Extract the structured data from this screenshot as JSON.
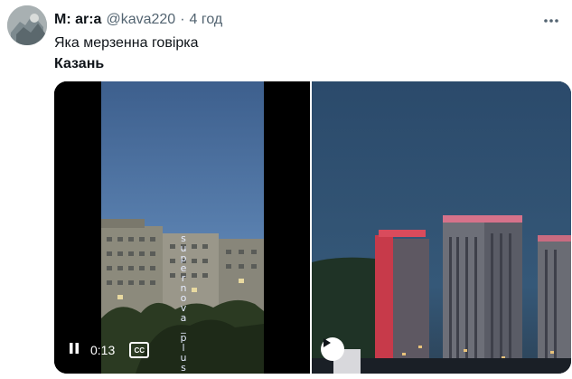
{
  "tweet": {
    "display_name": "M: ar:a",
    "handle": "@kava220",
    "separator": "·",
    "time": "4 год",
    "text": "Яка мерзенна говірка",
    "bold_text": "Казань"
  },
  "video_left": {
    "elapsed": "0:13",
    "watermark": "supernova_plus",
    "icons": [
      "pause-icon",
      "closed-captions-icon"
    ],
    "cc_label": "CC"
  },
  "video_right": {
    "icons": [
      "play-icon"
    ]
  },
  "icons": {
    "more": "more-dots-icon"
  },
  "colors": {
    "text": "#0f1419",
    "muted": "#536471",
    "sky_left": "#4a6f9c",
    "sky_right": "#2f4c6a"
  }
}
